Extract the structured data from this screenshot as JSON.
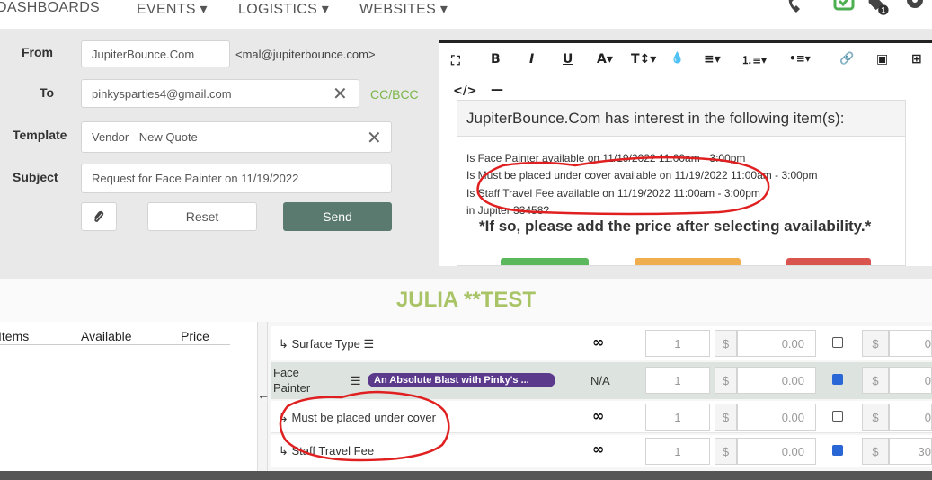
{
  "nav": {
    "items": [
      "DASHBOARDS",
      "EVENTS ▾",
      "LOGISTICS ▾",
      "WEBSITES ▾"
    ],
    "badge": "1"
  },
  "email": {
    "from_label": "From",
    "from_value": "JupiterBounce.Com",
    "from_address": "<mal@jupiterbounce.com>",
    "to_label": "To",
    "to_value": "pinkysparties4@gmail.com",
    "cc_bcc": "CC/BCC",
    "template_label": "Template",
    "template_value": "Vendor - New Quote",
    "subject_label": "Subject",
    "subject_value": "Request for Face Painter on 11/19/2022",
    "reset_label": "Reset",
    "send_label": "Send"
  },
  "editor": {
    "toolbar": [
      "⛶",
      "B",
      "I",
      "U",
      "A▾",
      "T↕▾",
      "💧",
      "≡▾",
      "⒈≡▾",
      "•≡▾",
      "🔗",
      "▣",
      "⊞"
    ],
    "toolbar2": [
      "</>",
      "—"
    ],
    "heading": "JupiterBounce.Com has interest in the following item(s):",
    "lines": [
      "Is Face Painter available on 11/19/2022 11:00am - 3:00pm",
      "Is  Must be placed under cover available on 11/19/2022 11:00am - 3:00pm",
      "Is  Staff Travel Fee available on 11/19/2022 11:00am - 3:00pm",
      "in Jupiter 33458?"
    ],
    "big_line": "*If so, please add the price after selecting availability.*",
    "button_colors": [
      "#5cb85c",
      "#f0ad4e",
      "#d9534f"
    ]
  },
  "section_title": "JULIA **TEST",
  "left_table": {
    "headers": [
      "Items",
      "Available",
      "Price"
    ]
  },
  "rows": [
    {
      "name": "Surface Type",
      "avail": "∞",
      "qty": "1",
      "currency": "$",
      "price": "0.00",
      "checked": false,
      "currency2": "$",
      "price2": "0"
    },
    {
      "name": "Face Painter",
      "vendor": "An Absolute Blast with Pinky's ...",
      "avail": "N/A",
      "qty": "1",
      "currency": "$",
      "price": "0.00",
      "checked": true,
      "currency2": "$",
      "price2": "0"
    },
    {
      "name": "Must be placed under cover",
      "avail": "∞",
      "qty": "1",
      "currency": "$",
      "price": "0.00",
      "checked": false,
      "currency2": "$",
      "price2": "0"
    },
    {
      "name": "Staff Travel Fee",
      "avail": "∞",
      "qty": "1",
      "currency": "$",
      "price": "0.00",
      "checked": true,
      "currency2": "$",
      "price2": "30"
    }
  ],
  "colors": {
    "send_button": "#5a7a70",
    "julia": "#a8c466",
    "cc_bcc": "#7ab648",
    "vendor_badge": "#5b3a8c",
    "highlight_row": "#dde4e0",
    "annotation": "#e02020"
  },
  "icons": [
    "phone-icon",
    "check-square-icon",
    "tag-icon",
    "gear-icon",
    "paperclip-icon",
    "arrow-left-icon",
    "list-icon",
    "close-icon"
  ]
}
